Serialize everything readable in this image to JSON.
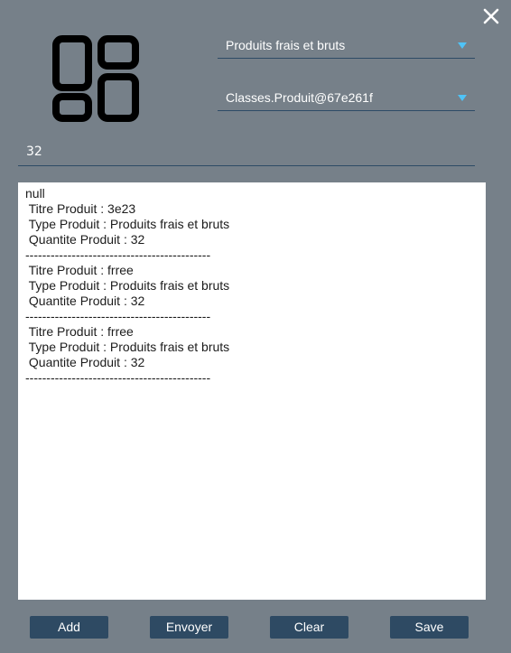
{
  "window": {
    "close_icon": "close-icon",
    "accent_color": "#4fc3f7",
    "button_color": "#2e4a63",
    "background_color": "#768089"
  },
  "logo": {
    "icon": "grid-layout-icon"
  },
  "type_select": {
    "value": "Produits frais et bruts"
  },
  "product_select": {
    "value": "Classes.Produit@67e261f"
  },
  "quantity_field": {
    "value": "32"
  },
  "output": {
    "lines": [
      "null",
      " Titre Produit : 3e23",
      " Type Produit : Produits frais et bruts",
      " Quantite Produit : 32",
      "--------------------------------------------",
      " Titre Produit : frree",
      " Type Produit : Produits frais et bruts",
      " Quantite Produit : 32",
      "--------------------------------------------",
      " Titre Produit : frree",
      " Type Produit : Produits frais et bruts",
      " Quantite Produit : 32",
      "--------------------------------------------"
    ]
  },
  "buttons": {
    "add": "Add",
    "envoyer": "Envoyer",
    "clear": "Clear",
    "save": "Save"
  }
}
